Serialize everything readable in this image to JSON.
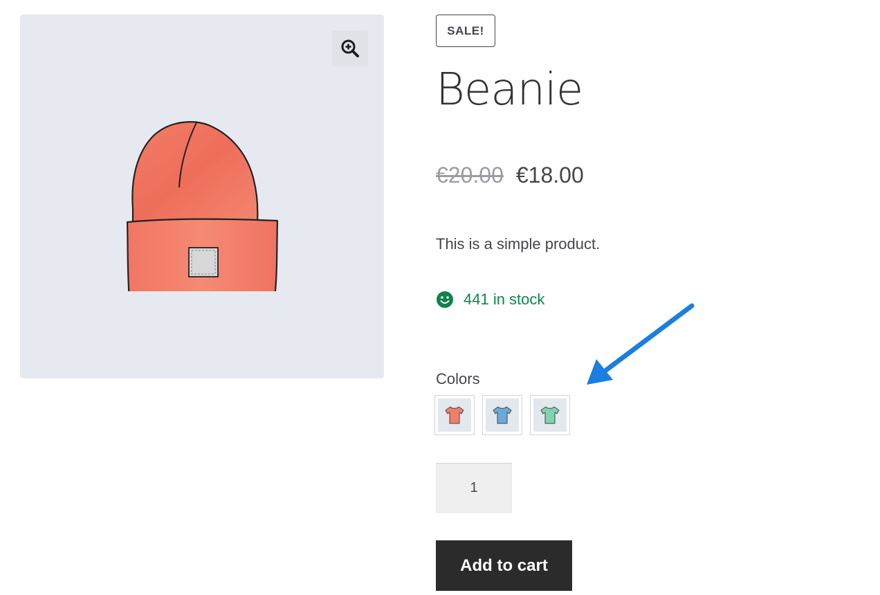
{
  "product": {
    "badge": "SALE!",
    "title": "Beanie",
    "price_old": "€20.00",
    "price_new": "€18.00",
    "description": "This is a simple product.",
    "stock_text": "441 in stock",
    "stock_icon": "smiley-icon",
    "product_image": "red-beanie-illustration",
    "zoom_icon": "magnifier-plus-icon"
  },
  "variations": {
    "label": "Colors",
    "swatches": [
      {
        "name": "red",
        "icon": "tshirt-icon",
        "color": "#f07f68"
      },
      {
        "name": "blue",
        "icon": "tshirt-icon",
        "color": "#6aaad6"
      },
      {
        "name": "green",
        "icon": "tshirt-icon",
        "color": "#7fd3b1"
      }
    ]
  },
  "cart": {
    "quantity": "1",
    "add_label": "Add to cart"
  },
  "annotation": {
    "arrow_color": "#1a7fe0"
  },
  "colors": {
    "stock_green": "#0f834d",
    "button_dark": "#2b2b2b",
    "gallery_bg": "#e6eaf0"
  }
}
